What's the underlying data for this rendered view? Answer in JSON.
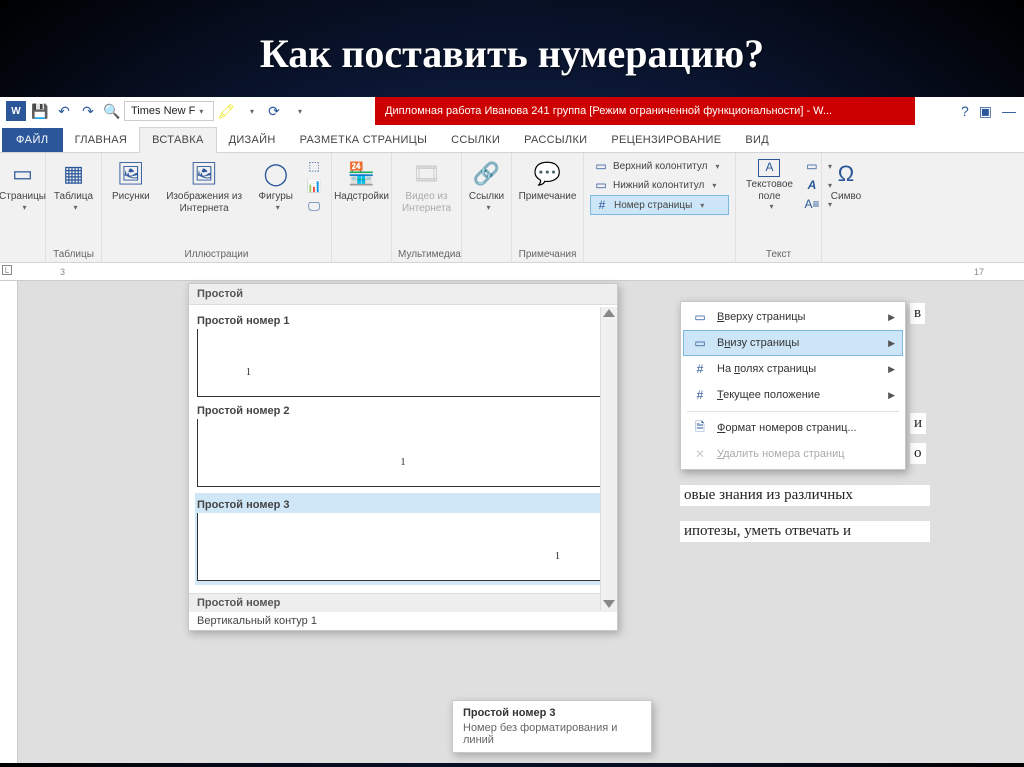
{
  "slide": {
    "title": "Как поставить нумерацию?"
  },
  "qat": {
    "font": "Times New F"
  },
  "title_bar": {
    "doc_title": "Дипломная работа Иванова 241 группа [Режим ограниченной функциональности]  -  W..."
  },
  "tabs": {
    "file": "ФАЙЛ",
    "home": "ГЛАВНАЯ",
    "insert": "ВСТАВКА",
    "design": "ДИЗАЙН",
    "layout": "РАЗМЕТКА СТРАНИЦЫ",
    "references": "ССЫЛКИ",
    "mailings": "РАССЫЛКИ",
    "review": "РЕЦЕНЗИРОВАНИЕ",
    "view": "ВИД"
  },
  "ribbon": {
    "pages": "Страницы",
    "table": "Таблица",
    "tables_group": "Таблицы",
    "pictures": "Рисунки",
    "online_pictures": "Изображения из Интернета",
    "shapes": "Фигуры",
    "illustrations_group": "Иллюстрации",
    "addins": "Надстройки",
    "online_video": "Видео из Интернета",
    "media_group": "Мультимедиа",
    "links": "Ссылки",
    "comment": "Примечание",
    "comments_group": "Примечания",
    "header": "Верхний колонтитул",
    "footer": "Нижний колонтитул",
    "page_number": "Номер страницы",
    "text_box": "Текстовое поле",
    "text_group": "Текст",
    "symbols": "Симво"
  },
  "page_number_menu": {
    "top": "Вверху страницы",
    "bottom": "Внизу страницы",
    "margins": "На полях страницы",
    "current": "Текущее положение",
    "format": "Формат номеров страниц...",
    "remove": "Удалить номера страниц"
  },
  "gallery": {
    "header_simple": "Простой",
    "item1": "Простой номер 1",
    "item2": "Простой номер 2",
    "item3": "Простой номер 3",
    "footer_simple": "Простой номер",
    "sub": "Вертикальный контур 1",
    "preview_digit": "1"
  },
  "tooltip": {
    "title": "Простой номер 3",
    "body": "Номер без форматирования и линий"
  },
  "ruler_marks": [
    "3",
    "17"
  ],
  "doc_fragments": {
    "f1": "в",
    "f2": "и",
    "f3": "о",
    "f4": "овые знания из различных",
    "f5": "ипотезы, уметь отвечать и"
  }
}
